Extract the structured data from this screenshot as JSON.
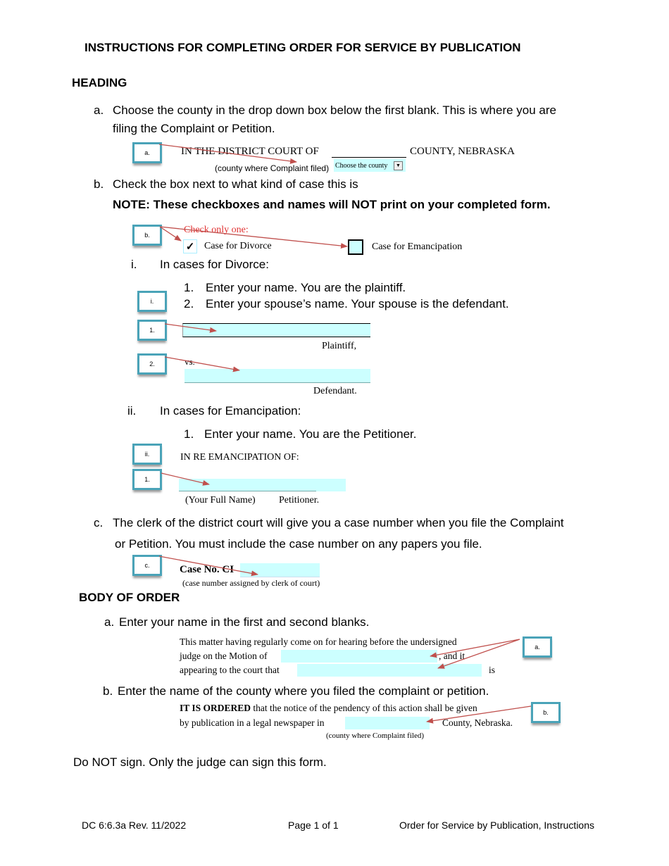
{
  "title": "INSTRUCTIONS FOR COMPLETING ORDER FOR SERVICE BY PUBLICATION",
  "heading_section": {
    "label": "HEADING",
    "a": {
      "marker": "a.",
      "text_line1": "Choose the county in the drop down box below the first blank. This is where you are",
      "text_line2": "filing the Complaint or Petition.",
      "tag": "a.",
      "court_prefix": "IN THE DISTRICT  COURT OF",
      "court_suffix": "COUNTY, NEBRASKA",
      "county_caption": "(county where Complaint filed)",
      "dropdown_value": "Choose the county"
    },
    "b": {
      "marker": "b.",
      "text": "Check the box next to what kind of case this is",
      "note": "NOTE: These checkboxes and names will NOT print on your completed form.",
      "tag": "b.",
      "check_only": "Check only one:",
      "divorce_label": "Case for Divorce",
      "divorce_checked": true,
      "emancipation_label": "Case for Emancipation",
      "emancipation_checked": false,
      "check_glyph": "✓"
    },
    "i": {
      "marker": "i.",
      "heading": "In cases for Divorce:",
      "steps": [
        {
          "num": "1.",
          "text": "Enter your name. You are the plaintiff."
        },
        {
          "num": "2.",
          "text": "Enter your spouse’s name. Your spouse is the defendant."
        }
      ],
      "tag_i": "i.",
      "tag_1": "1.",
      "tag_2": "2.",
      "plaintiff_label": "Plaintiff,",
      "vs_label": "vs.",
      "defendant_label": "Defendant."
    },
    "ii": {
      "marker": "ii.",
      "heading": "In cases for Emancipation:",
      "steps": [
        {
          "num": "1.",
          "text": "Enter your name. You are the Petitioner."
        }
      ],
      "tag_ii": "ii.",
      "tag_1": "1.",
      "in_re": "IN RE EMANCIPATION OF:",
      "full_name_caption": "(Your Full Name)",
      "petitioner_label": "Petitioner."
    },
    "c": {
      "marker": "c.",
      "text_line1": "The clerk of the district court will give you a case number when you file the Complaint",
      "text_line2": "or Petition. You must include the case number on any papers you file.",
      "tag": "c.",
      "case_no_label": "Case No. CI",
      "case_caption": "(case number assigned by clerk of court)"
    }
  },
  "body_section": {
    "label": "BODY OF ORDER",
    "a": {
      "marker": "a.",
      "text": "Enter your name in the first and second blanks.",
      "tag": "a.",
      "line1": "This matter having regularly come on for hearing before the undersigned",
      "line2_prefix": "judge on the Motion of",
      "line2_suffix": ", and it",
      "line3_prefix": "appearing to the court that",
      "line3_suffix": "is"
    },
    "b": {
      "marker": "b.",
      "text": "Enter the name of the county where you filed the complaint or petition.",
      "tag": "b.",
      "ordered_bold": "IT IS ORDERED",
      "ordered_rest": " that the notice of the pendency of this action shall be given",
      "line2_prefix": "by publication in a legal newspaper in",
      "line2_suffix": "County, Nebraska.",
      "caption": "(county where Complaint filed)"
    }
  },
  "closing_note": "Do NOT sign. Only the judge can sign this form.",
  "footer": {
    "form_id": "DC 6:6.3a  Rev. 11/2022",
    "page": "Page 1 of 1",
    "doc_title": "Order for Service by Publication, Instructions"
  },
  "colors": {
    "field_fill": "#ccffff",
    "tag_border": "#4aa3b8",
    "arrow": "#c0504d",
    "check_only_text": "#e03030"
  }
}
